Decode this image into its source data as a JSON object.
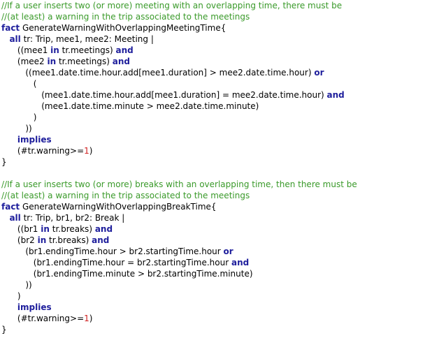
{
  "editor": {
    "colors": {
      "comment": "#3a9a2a",
      "keyword": "#1e1e9c",
      "number": "#d02020",
      "text": "#000000",
      "background": "#ffffff"
    },
    "lines": [
      {
        "indent": "",
        "tokens": [
          {
            "t": "comment",
            "s": "//If a user inserts two (or more) meeting with an overlapping time, there must be"
          }
        ]
      },
      {
        "indent": "",
        "tokens": [
          {
            "t": "comment",
            "s": "//(at least) a warning in the trip associated to the meetings"
          }
        ]
      },
      {
        "indent": "",
        "tokens": [
          {
            "t": "keyword",
            "s": "fact"
          },
          {
            "t": "text",
            "s": " GenerateWarningWithOverlappingMeetingTime{"
          }
        ]
      },
      {
        "indent": "   ",
        "tokens": [
          {
            "t": "keyword",
            "s": "all"
          },
          {
            "t": "text",
            "s": " tr: Trip, mee1, mee2: Meeting |"
          }
        ]
      },
      {
        "indent": "      ",
        "tokens": [
          {
            "t": "text",
            "s": "((mee1 "
          },
          {
            "t": "keyword",
            "s": "in"
          },
          {
            "t": "text",
            "s": " tr.meetings) "
          },
          {
            "t": "keyword",
            "s": "and"
          }
        ]
      },
      {
        "indent": "      ",
        "tokens": [
          {
            "t": "text",
            "s": "(mee2 "
          },
          {
            "t": "keyword",
            "s": "in"
          },
          {
            "t": "text",
            "s": " tr.meetings) "
          },
          {
            "t": "keyword",
            "s": "and"
          }
        ]
      },
      {
        "indent": "         ",
        "tokens": [
          {
            "t": "text",
            "s": "((mee1.date.time.hour.add[mee1.duration] > mee2.date.time.hour) "
          },
          {
            "t": "keyword",
            "s": "or"
          }
        ]
      },
      {
        "indent": "            ",
        "tokens": [
          {
            "t": "text",
            "s": "("
          }
        ]
      },
      {
        "indent": "               ",
        "tokens": [
          {
            "t": "text",
            "s": "(mee1.date.time.hour.add[mee1.duration] = mee2.date.time.hour) "
          },
          {
            "t": "keyword",
            "s": "and"
          }
        ]
      },
      {
        "indent": "               ",
        "tokens": [
          {
            "t": "text",
            "s": "(mee1.date.time.minute > mee2.date.time.minute)"
          }
        ]
      },
      {
        "indent": "            ",
        "tokens": [
          {
            "t": "text",
            "s": ")"
          }
        ]
      },
      {
        "indent": "         ",
        "tokens": [
          {
            "t": "text",
            "s": "))"
          }
        ]
      },
      {
        "indent": "      ",
        "tokens": [
          {
            "t": "keyword",
            "s": "implies"
          }
        ]
      },
      {
        "indent": "      ",
        "tokens": [
          {
            "t": "text",
            "s": "(#tr.warning>="
          },
          {
            "t": "number",
            "s": "1"
          },
          {
            "t": "text",
            "s": ")"
          }
        ]
      },
      {
        "indent": "",
        "tokens": [
          {
            "t": "text",
            "s": "}"
          }
        ]
      },
      {
        "indent": "",
        "tokens": []
      },
      {
        "indent": "",
        "tokens": [
          {
            "t": "comment",
            "s": "//If a user inserts two (or more) breaks with an overlapping time, then there must be"
          }
        ]
      },
      {
        "indent": "",
        "tokens": [
          {
            "t": "comment",
            "s": "//(at least) a warning in the trip associated to the meetings"
          }
        ]
      },
      {
        "indent": "",
        "tokens": [
          {
            "t": "keyword",
            "s": "fact"
          },
          {
            "t": "text",
            "s": " GenerateWarningWithOverlappingBreakTime{"
          }
        ]
      },
      {
        "indent": "   ",
        "tokens": [
          {
            "t": "keyword",
            "s": "all"
          },
          {
            "t": "text",
            "s": " tr: Trip, br1, br2: Break |"
          }
        ]
      },
      {
        "indent": "      ",
        "tokens": [
          {
            "t": "text",
            "s": "((br1 "
          },
          {
            "t": "keyword",
            "s": "in"
          },
          {
            "t": "text",
            "s": " tr.breaks) "
          },
          {
            "t": "keyword",
            "s": "and"
          }
        ]
      },
      {
        "indent": "      ",
        "tokens": [
          {
            "t": "text",
            "s": "(br2 "
          },
          {
            "t": "keyword",
            "s": "in"
          },
          {
            "t": "text",
            "s": " tr.breaks) "
          },
          {
            "t": "keyword",
            "s": "and"
          }
        ]
      },
      {
        "indent": "         ",
        "tokens": [
          {
            "t": "text",
            "s": "(br1.endingTime.hour > br2.startingTime.hour "
          },
          {
            "t": "keyword",
            "s": "or"
          }
        ]
      },
      {
        "indent": "            ",
        "tokens": [
          {
            "t": "text",
            "s": "(br1.endingTime.hour = br2.startingTime.hour "
          },
          {
            "t": "keyword",
            "s": "and"
          }
        ]
      },
      {
        "indent": "            ",
        "tokens": [
          {
            "t": "text",
            "s": "(br1.endingTime.minute > br2.startingTime.minute)"
          }
        ]
      },
      {
        "indent": "         ",
        "tokens": [
          {
            "t": "text",
            "s": "))"
          }
        ]
      },
      {
        "indent": "      ",
        "tokens": [
          {
            "t": "text",
            "s": ")"
          }
        ]
      },
      {
        "indent": "      ",
        "tokens": [
          {
            "t": "keyword",
            "s": "implies"
          }
        ]
      },
      {
        "indent": "      ",
        "tokens": [
          {
            "t": "text",
            "s": "(#tr.warning>="
          },
          {
            "t": "number",
            "s": "1"
          },
          {
            "t": "text",
            "s": ")"
          }
        ]
      },
      {
        "indent": "",
        "tokens": [
          {
            "t": "text",
            "s": "}"
          }
        ]
      }
    ]
  }
}
